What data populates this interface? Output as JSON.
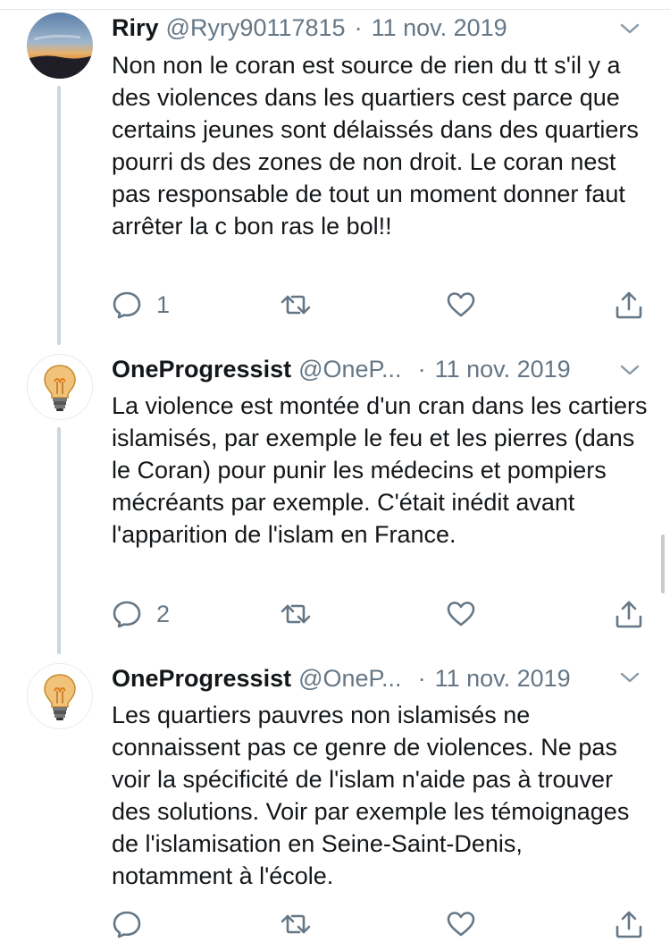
{
  "tweets": [
    {
      "name": "Riry",
      "handle": "@Ryry90117815",
      "separator": "·",
      "date": "11 nov. 2019",
      "text": "Non non le coran est source de rien du tt s'il y a des violences dans les quartiers cest parce que certains jeunes sont délaissés dans des quartiers pourri ds des zones de non droit. Le coran nest pas responsable de tout un moment donner faut arrêter la c bon ras le bol!!",
      "reply_count": "1",
      "avatar_icon": "sunset-avatar"
    },
    {
      "name": "OneProgressist",
      "handle": "@OneP...",
      "separator": "·",
      "date": "11 nov. 2019",
      "text": "La violence est montée d'un cran dans les cartiers islamisés, par exemple le feu et les pierres (dans le Coran) pour punir les médecins et pompiers mécréants par exemple. C'était inédit avant l'apparition de l'islam en France.",
      "reply_count": "2",
      "avatar_icon": "lightbulb-avatar"
    },
    {
      "name": "OneProgressist",
      "handle": "@OneP...",
      "separator": "·",
      "date": "11 nov. 2019",
      "text": "Les quartiers pauvres non islamisés ne connaissent pas ce genre de violences. Ne pas voir la spécificité de l'islam n'aide pas à trouver des solutions. Voir par exemple les témoignages de l'islamisation en Seine-Saint-Denis, notamment à l'école.",
      "reply_count": "",
      "avatar_icon": "lightbulb-avatar"
    }
  ],
  "icons": {
    "reply": "reply-icon",
    "retweet": "retweet-icon",
    "like": "heart-icon",
    "share": "share-icon",
    "menu": "chevron-down-icon"
  },
  "colors": {
    "text": "#14171a",
    "secondary": "#657786",
    "thread_line": "#ccd6dd"
  }
}
